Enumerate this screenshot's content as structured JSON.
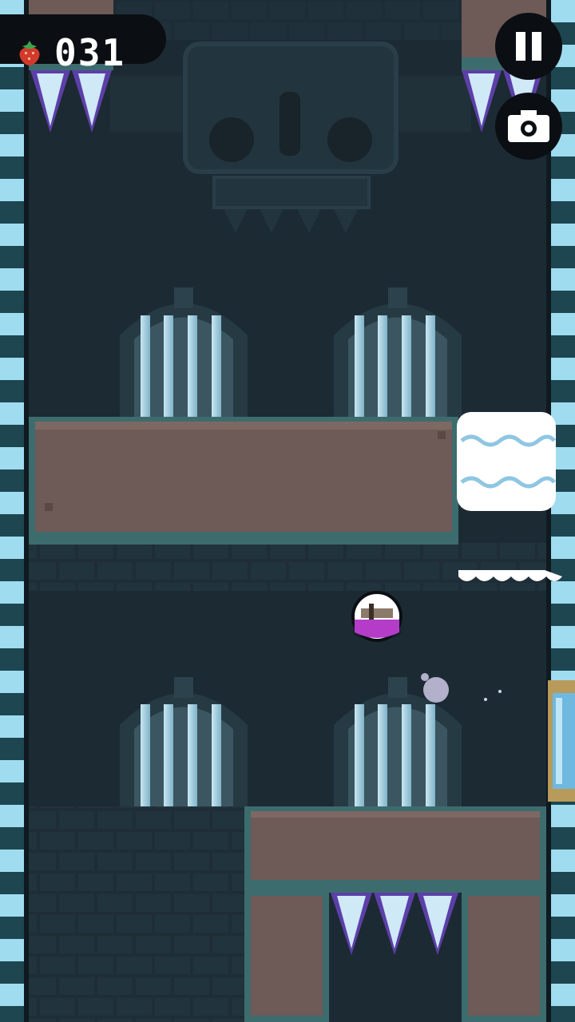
{
  "hud": {
    "score": "031",
    "collectible_icon": "strawberry-icon",
    "pause_icon": "pause-icon",
    "camera_icon": "camera-icon"
  },
  "colors": {
    "wall_bg": "#1e2d36",
    "brick": "#263a44",
    "stone_block": "#6e5a56",
    "stone_edge": "#3d6c6e",
    "ice_spike": "#cfe9f7",
    "spike_shadow": "#5c3fa8",
    "snow": "#eaf6fb",
    "player_body": "#b43cc8",
    "hud_bg": "#0b0f14",
    "gold_frame": "#b89a5a"
  }
}
